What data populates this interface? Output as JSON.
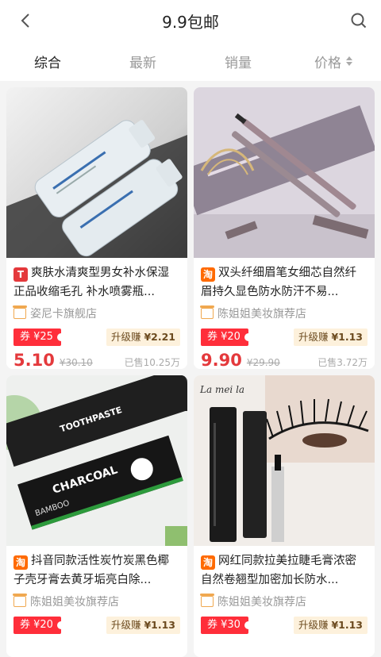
{
  "header": {
    "title": "9.9包邮",
    "back_icon": "chevron-left-icon",
    "search_icon": "search-icon"
  },
  "tabs": [
    {
      "label": "综合",
      "active": true
    },
    {
      "label": "最新",
      "active": false
    },
    {
      "label": "销量",
      "active": false
    },
    {
      "label": "价格",
      "active": false
    }
  ],
  "products": [
    {
      "platform": "tmall",
      "badge": "T",
      "title": "爽肤水清爽型男女补水保湿正品收缩毛孔 补水喷雾瓶...",
      "shop": "姿尼卡旗舰店",
      "coupon": "券 ¥25",
      "upgrade_label": "升级赚",
      "upgrade_amount": "¥2.21",
      "price": "5.10",
      "orig_price": "¥30.10",
      "sold": "已售10.25万"
    },
    {
      "platform": "taobao",
      "badge": "淘",
      "title": "双头纤细眉笔女细芯自然纤眉持久显色防水防汗不易...",
      "shop": "陈姐姐美妆旗荐店",
      "coupon": "券 ¥20",
      "upgrade_label": "升级赚",
      "upgrade_amount": "¥1.13",
      "price": "9.90",
      "orig_price": "¥29.90",
      "sold": "已售3.72万"
    },
    {
      "platform": "taobao",
      "badge": "淘",
      "title": "抖音同款活性炭竹炭黑色椰子壳牙膏去黄牙垢亮白除...",
      "shop": "陈姐姐美妆旗荐店",
      "coupon": "券 ¥20",
      "upgrade_label": "升级赚",
      "upgrade_amount": "¥1.13"
    },
    {
      "platform": "taobao",
      "badge": "淘",
      "title": "网红同款拉美拉睫毛膏浓密自然卷翘型加密加长防水...",
      "shop": "陈姐姐美妆旗荐店",
      "coupon": "券 ¥30",
      "upgrade_label": "升级赚",
      "upgrade_amount": "¥1.13"
    }
  ],
  "image_text": {
    "charcoal": "CHARCOAL",
    "bamboo": "BAMBOO",
    "toothpaste": "TOOTHPASTE",
    "mascara_brand": "La mei la"
  }
}
